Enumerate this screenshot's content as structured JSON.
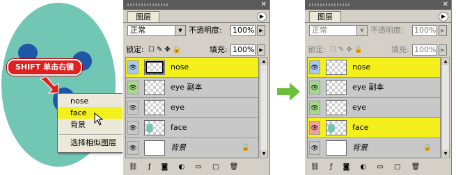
{
  "callout": {
    "text": "SHIFT 单击右键"
  },
  "context_menu": {
    "items": [
      "nose",
      "face",
      "背景"
    ],
    "selected": "face",
    "extra": "选择相似图层"
  },
  "panels": {
    "left": {
      "tab": "图层",
      "blend_mode": "正常",
      "opacity_label": "不透明度:",
      "opacity": "100%",
      "lock_label": "锁定:",
      "fill_label": "填充:",
      "fill": "100%",
      "layers": [
        {
          "name": "nose",
          "selected": true
        },
        {
          "name": "eye 副本",
          "selected": false
        },
        {
          "name": "eye",
          "selected": false
        },
        {
          "name": "face",
          "selected": false
        },
        {
          "name": "背景",
          "selected": false
        }
      ]
    },
    "right": {
      "tab": "图层",
      "blend_mode": "正常",
      "opacity_label": "不透明度:",
      "opacity": "100%",
      "lock_label": "锁定:",
      "fill_label": "填充:",
      "fill": "100%",
      "layers": [
        {
          "name": "nose",
          "selected": true
        },
        {
          "name": "eye 副本",
          "selected": false
        },
        {
          "name": "eye",
          "selected": false
        },
        {
          "name": "face",
          "selected": true
        },
        {
          "name": "背景",
          "selected": false
        }
      ]
    }
  },
  "colors": {
    "face": "#72c6b4",
    "eyes": "#1e56a8",
    "selection": "#f3f01c",
    "link_green": "#a6d98a",
    "link_red": "#f2a0a0",
    "arrow": "#6cbf3c",
    "callout": "#e02020"
  }
}
